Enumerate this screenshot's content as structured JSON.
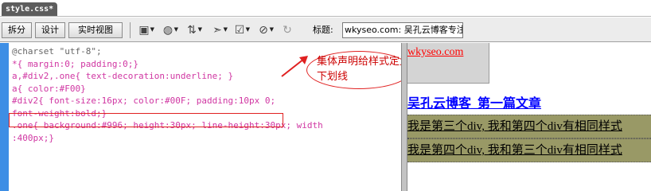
{
  "tabs": [
    {
      "label": "style.css*"
    }
  ],
  "toolbar": {
    "split_label": "拆分",
    "design_label": "设计",
    "live_view_label": "实时视图",
    "title_label": "标题:",
    "title_value": "wkyseo.com: 吴孔云博客专注"
  },
  "editor": {
    "lines": [
      "@charset \"utf-8\";",
      "*{ margin:0; padding:0;}",
      "a,#div2,.one{ text-decoration:underline; }",
      "a{ color:#F00}",
      "#div2{ font-size:16px; color:#00F; padding:10px 0;",
      "font-weight:bold;}",
      ".one{ background:#996; height:30px; line-height:30px; width",
      ":400px;}"
    ]
  },
  "annotation": {
    "text": "集体声明给样式定义下划线"
  },
  "design": {
    "link_text": "wkyseo.com",
    "title_text": "吴孔云博客_第一篇文章",
    "row1_text": "我是第三个div, 我和第四个div有相同样式",
    "row2_text": "我是第四个div, 我和第三个div有相同样式"
  },
  "colors": {
    "gutter": "#3d8ee5",
    "highlight_border": "#e02020",
    "design_row_bg": "#999966",
    "link_red": "#ff0000",
    "title_blue": "#0000ff"
  }
}
